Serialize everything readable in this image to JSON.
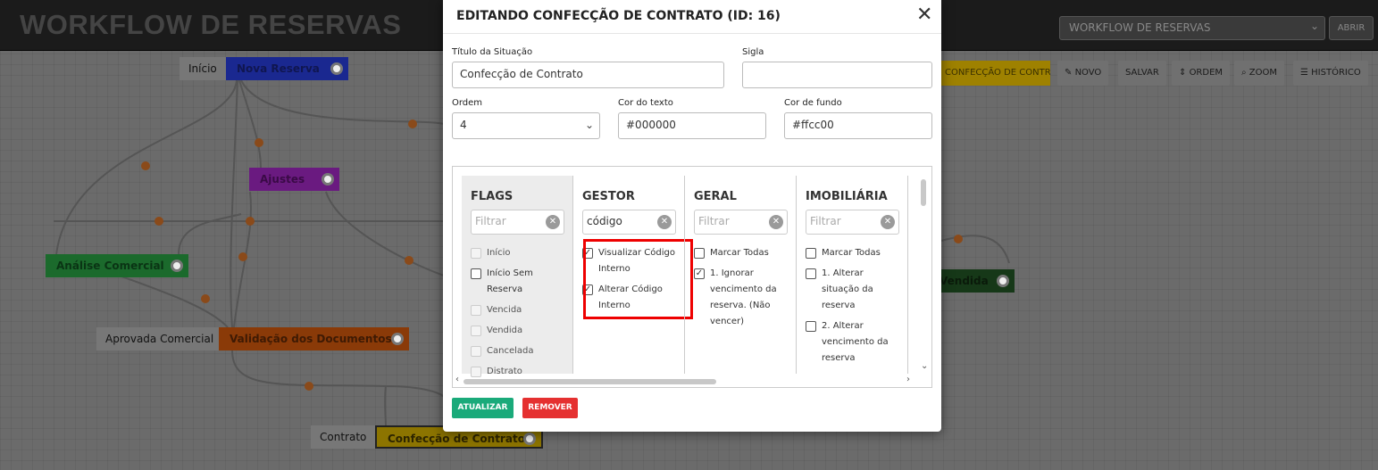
{
  "app": {
    "title": "WORKFLOW DE RESERVAS",
    "workflow_select": "WORKFLOW DE RESERVAS",
    "open_label": "ABRIR"
  },
  "toolbar": {
    "current_status": "CONFECÇÃO DE CONTRATO",
    "new_label": "NOVO",
    "save_label": "SALVAR",
    "order_label": "ORDEM",
    "zoom_label": "ZOOM",
    "history_label": "HISTÓRICO"
  },
  "diagram": {
    "labels": {
      "inicio": "Início",
      "aprovada": "Aprovada Comercial",
      "contrato": "Contrato"
    },
    "nodes": {
      "nova_reserva": "Nova Reserva",
      "ajustes": "Ajustes",
      "analise": "Análise Comercial",
      "validacao": "Validação dos Documentos",
      "confeccao": "Confecção de Contrato",
      "vendida": "Vendida"
    }
  },
  "modal": {
    "title": "EDITANDO CONFECÇÃO DE CONTRATO (ID: 16)",
    "fields": {
      "titulo_label": "Título da Situação",
      "titulo_value": "Confecção de Contrato",
      "sigla_label": "Sigla",
      "sigla_value": "",
      "ordem_label": "Ordem",
      "ordem_value": "4",
      "cor_texto_label": "Cor do texto",
      "cor_texto_value": "#000000",
      "cor_fundo_label": "Cor de fundo",
      "cor_fundo_value": "#ffcc00"
    },
    "columns": {
      "flags": {
        "title": "FLAGS",
        "filter_placeholder": "Filtrar",
        "items": [
          "Início",
          "Início Sem Reserva",
          "Vencida",
          "Vendida",
          "Cancelada",
          "Distrato"
        ]
      },
      "gestor": {
        "title": "GESTOR",
        "filter_value": "código",
        "items": [
          "Visualizar Código Interno",
          "Alterar Código Interno"
        ]
      },
      "geral": {
        "title": "GERAL",
        "filter_placeholder": "Filtrar",
        "items": [
          "Marcar Todas",
          "1. Ignorar vencimento da reserva. (Não vencer)"
        ]
      },
      "imobiliaria": {
        "title": "IMOBILIÁRIA",
        "filter_placeholder": "Filtrar",
        "items": [
          "Marcar Todas",
          "1. Alterar situação da reserva",
          "2. Alterar vencimento da reserva"
        ]
      }
    },
    "buttons": {
      "update": "ATUALIZAR",
      "remove": "REMOVER"
    },
    "colors": {
      "update": "#1aaa7a",
      "remove": "#e53030",
      "highlight": "#ee0000"
    }
  }
}
